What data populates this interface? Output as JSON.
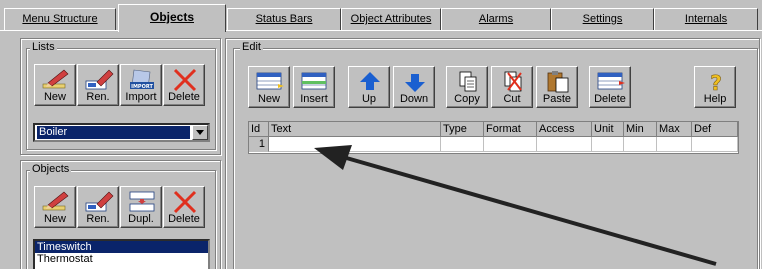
{
  "tabs": [
    {
      "label": "Menu Structure"
    },
    {
      "label": "Objects"
    },
    {
      "label": "Status Bars"
    },
    {
      "label": "Object Attributes"
    },
    {
      "label": "Alarms"
    },
    {
      "label": "Settings"
    },
    {
      "label": "Internals"
    }
  ],
  "lists_group": {
    "title": "Lists",
    "buttons": [
      {
        "label": "New",
        "icon": "pencil-new-icon"
      },
      {
        "label": "Ren.",
        "icon": "rename-icon"
      },
      {
        "label": "Import",
        "icon": "import-icon",
        "badge": "IMPORT"
      },
      {
        "label": "Delete",
        "icon": "delete-x-icon"
      }
    ],
    "selected_list": "Boiler"
  },
  "objects_group": {
    "title": "Objects",
    "buttons": [
      {
        "label": "New",
        "icon": "pencil-new-icon"
      },
      {
        "label": "Ren.",
        "icon": "rename-icon"
      },
      {
        "label": "Dupl.",
        "icon": "duplicate-icon"
      },
      {
        "label": "Delete",
        "icon": "delete-x-icon"
      }
    ],
    "items": [
      "Timeswitch",
      "Thermostat"
    ]
  },
  "edit_group": {
    "title": "Edit",
    "buttons": [
      {
        "label": "New",
        "icon": "new-row-icon"
      },
      {
        "label": "Insert",
        "icon": "insert-row-icon"
      },
      {
        "label": "Up",
        "icon": "arrow-up-icon"
      },
      {
        "label": "Down",
        "icon": "arrow-down-icon"
      },
      {
        "label": "Copy",
        "icon": "copy-icon"
      },
      {
        "label": "Cut",
        "icon": "cut-icon"
      },
      {
        "label": "Paste",
        "icon": "paste-icon"
      },
      {
        "label": "Delete",
        "icon": "delete-row-icon"
      },
      {
        "label": "Help",
        "icon": "help-icon"
      }
    ],
    "grid": {
      "columns": [
        "Id",
        "Text",
        "Type",
        "Format",
        "Access",
        "Unit",
        "Min",
        "Max",
        "Def"
      ],
      "rows": [
        {
          "id": "1",
          "text": "",
          "type": "",
          "format": "",
          "access": "",
          "unit": "",
          "min": "",
          "max": "",
          "def": ""
        }
      ]
    }
  },
  "colors": {
    "face": "#c0c0c0",
    "selection": "#0a246a",
    "arrow_annotation": "#222222",
    "blue_arrow": "#1a5fd0",
    "delete_red": "#e0301e"
  }
}
